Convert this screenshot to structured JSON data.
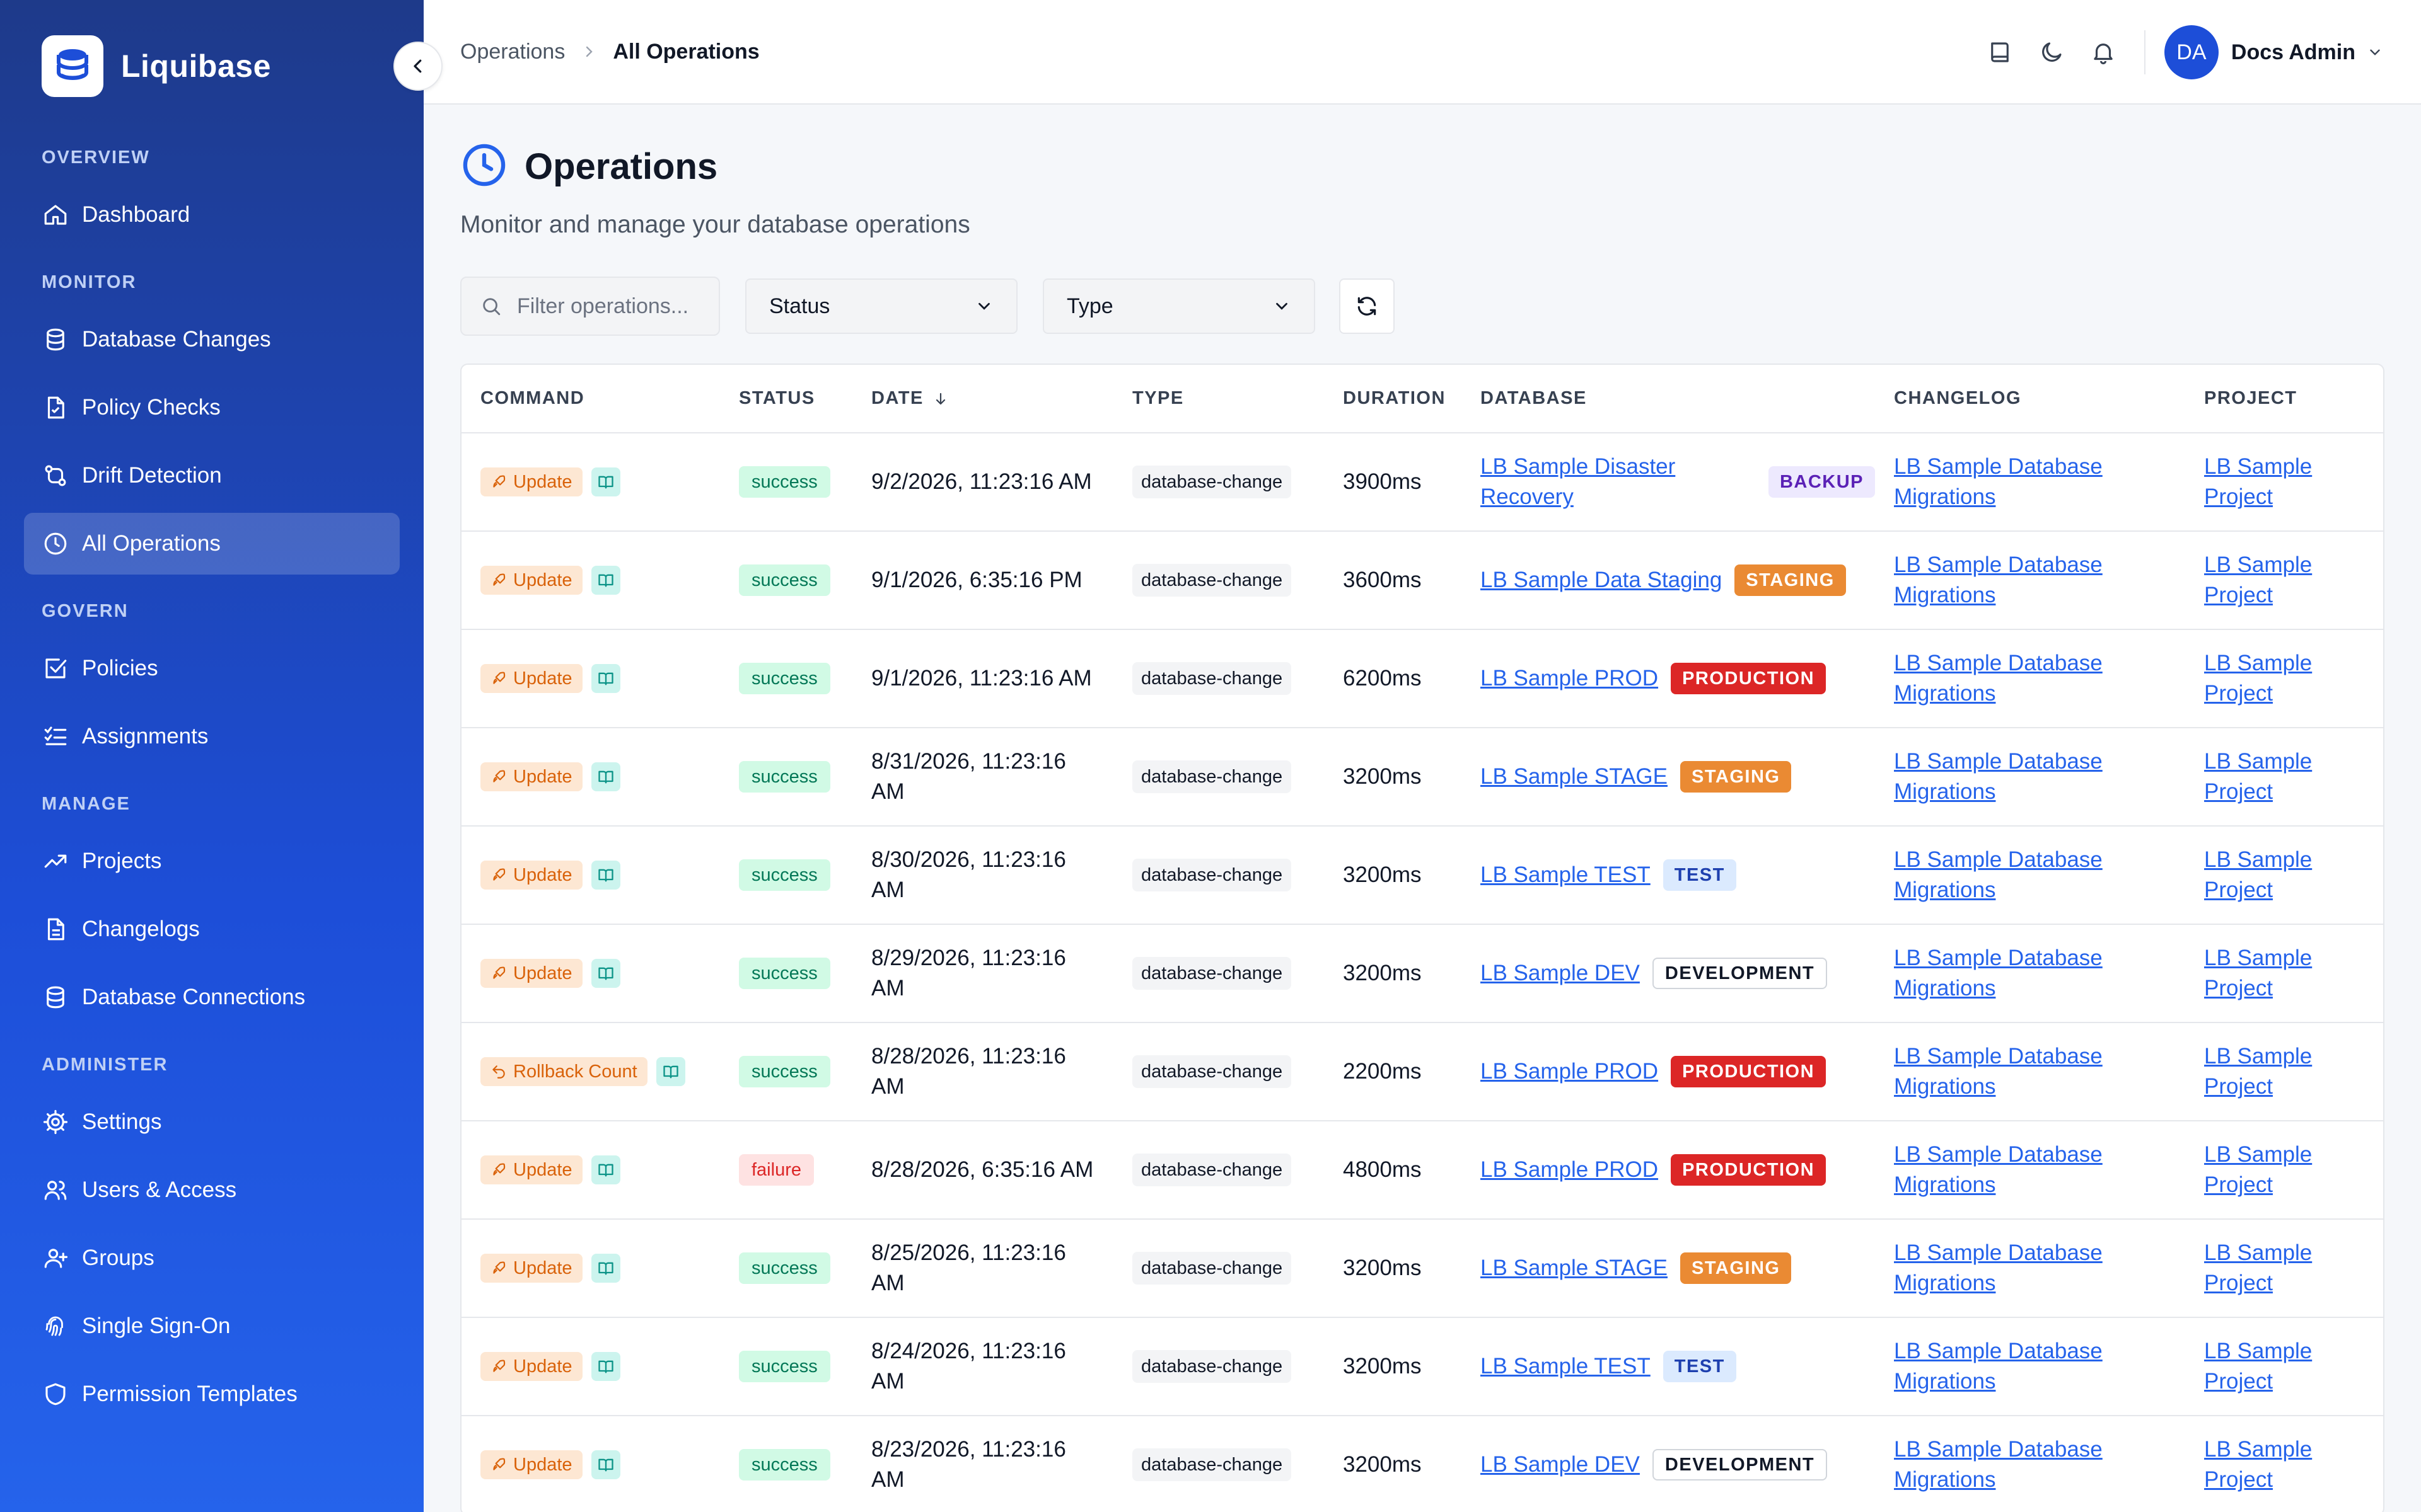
{
  "brand": {
    "name": "Liquibase"
  },
  "nav": {
    "sections": [
      {
        "title": "OVERVIEW",
        "items": [
          {
            "label": "Dashboard",
            "icon": "home-icon",
            "active": false
          }
        ]
      },
      {
        "title": "MONITOR",
        "items": [
          {
            "label": "Database Changes",
            "icon": "database-icon",
            "active": false
          },
          {
            "label": "Policy Checks",
            "icon": "file-check-icon",
            "active": false
          },
          {
            "label": "Drift Detection",
            "icon": "git-compare-icon",
            "active": false
          },
          {
            "label": "All Operations",
            "icon": "clock-icon",
            "active": true
          }
        ]
      },
      {
        "title": "GOVERN",
        "items": [
          {
            "label": "Policies",
            "icon": "square-check-icon",
            "active": false
          },
          {
            "label": "Assignments",
            "icon": "list-check-icon",
            "active": false
          }
        ]
      },
      {
        "title": "MANAGE",
        "items": [
          {
            "label": "Projects",
            "icon": "trending-up-icon",
            "active": false
          },
          {
            "label": "Changelogs",
            "icon": "file-text-icon",
            "active": false
          },
          {
            "label": "Database Connections",
            "icon": "database-icon",
            "active": false
          }
        ]
      },
      {
        "title": "ADMINISTER",
        "items": [
          {
            "label": "Settings",
            "icon": "gear-icon",
            "active": false
          },
          {
            "label": "Users & Access",
            "icon": "users-icon",
            "active": false
          },
          {
            "label": "Groups",
            "icon": "user-plus-icon",
            "active": false
          },
          {
            "label": "Single Sign-On",
            "icon": "fingerprint-icon",
            "active": false
          },
          {
            "label": "Permission Templates",
            "icon": "shield-icon",
            "active": false
          }
        ]
      }
    ]
  },
  "breadcrumb": {
    "parent": "Operations",
    "current": "All Operations"
  },
  "user": {
    "initials": "DA",
    "name": "Docs Admin"
  },
  "page": {
    "title": "Operations",
    "subtitle": "Monitor and manage your database operations"
  },
  "filters": {
    "search_placeholder": "Filter operations...",
    "status_label": "Status",
    "type_label": "Type"
  },
  "table": {
    "columns": [
      "COMMAND",
      "STATUS",
      "DATE",
      "TYPE",
      "DURATION",
      "DATABASE",
      "CHANGELOG",
      "PROJECT"
    ],
    "rows": [
      {
        "command": "Update",
        "status": "success",
        "date": "9/2/2026, 11:23:16 AM",
        "type": "database-change",
        "duration": "3900ms",
        "database": "LB Sample Disaster Recovery",
        "env": "BACKUP",
        "changelog": "LB Sample Database Migrations",
        "project": "LB Sample Project"
      },
      {
        "command": "Update",
        "status": "success",
        "date": "9/1/2026, 6:35:16 PM",
        "type": "database-change",
        "duration": "3600ms",
        "database": "LB Sample Data Staging",
        "env": "STAGING",
        "changelog": "LB Sample Database Migrations",
        "project": "LB Sample Project"
      },
      {
        "command": "Update",
        "status": "success",
        "date": "9/1/2026, 11:23:16 AM",
        "type": "database-change",
        "duration": "6200ms",
        "database": "LB Sample PROD",
        "env": "PRODUCTION",
        "changelog": "LB Sample Database Migrations",
        "project": "LB Sample Project"
      },
      {
        "command": "Update",
        "status": "success",
        "date": "8/31/2026, 11:23:16 AM",
        "type": "database-change",
        "duration": "3200ms",
        "database": "LB Sample STAGE",
        "env": "STAGING",
        "changelog": "LB Sample Database Migrations",
        "project": "LB Sample Project"
      },
      {
        "command": "Update",
        "status": "success",
        "date": "8/30/2026, 11:23:16 AM",
        "type": "database-change",
        "duration": "3200ms",
        "database": "LB Sample TEST",
        "env": "TEST",
        "changelog": "LB Sample Database Migrations",
        "project": "LB Sample Project"
      },
      {
        "command": "Update",
        "status": "success",
        "date": "8/29/2026, 11:23:16 AM",
        "type": "database-change",
        "duration": "3200ms",
        "database": "LB Sample DEV",
        "env": "DEVELOPMENT",
        "changelog": "LB Sample Database Migrations",
        "project": "LB Sample Project"
      },
      {
        "command": "Rollback Count",
        "status": "success",
        "date": "8/28/2026, 11:23:16 AM",
        "type": "database-change",
        "duration": "2200ms",
        "database": "LB Sample PROD",
        "env": "PRODUCTION",
        "changelog": "LB Sample Database Migrations",
        "project": "LB Sample Project"
      },
      {
        "command": "Update",
        "status": "failure",
        "date": "8/28/2026, 6:35:16 AM",
        "type": "database-change",
        "duration": "4800ms",
        "database": "LB Sample PROD",
        "env": "PRODUCTION",
        "changelog": "LB Sample Database Migrations",
        "project": "LB Sample Project"
      },
      {
        "command": "Update",
        "status": "success",
        "date": "8/25/2026, 11:23:16 AM",
        "type": "database-change",
        "duration": "3200ms",
        "database": "LB Sample STAGE",
        "env": "STAGING",
        "changelog": "LB Sample Database Migrations",
        "project": "LB Sample Project"
      },
      {
        "command": "Update",
        "status": "success",
        "date": "8/24/2026, 11:23:16 AM",
        "type": "database-change",
        "duration": "3200ms",
        "database": "LB Sample TEST",
        "env": "TEST",
        "changelog": "LB Sample Database Migrations",
        "project": "LB Sample Project"
      },
      {
        "command": "Update",
        "status": "success",
        "date": "8/23/2026, 11:23:16 AM",
        "type": "database-change",
        "duration": "3200ms",
        "database": "LB Sample DEV",
        "env": "DEVELOPMENT",
        "changelog": "LB Sample Database Migrations",
        "project": "LB Sample Project"
      }
    ]
  },
  "colors": {
    "sidebar": "#1e3a8a",
    "accent": "#2563eb",
    "success": "#047857",
    "failure": "#dc2626",
    "command": "#d9620a"
  }
}
